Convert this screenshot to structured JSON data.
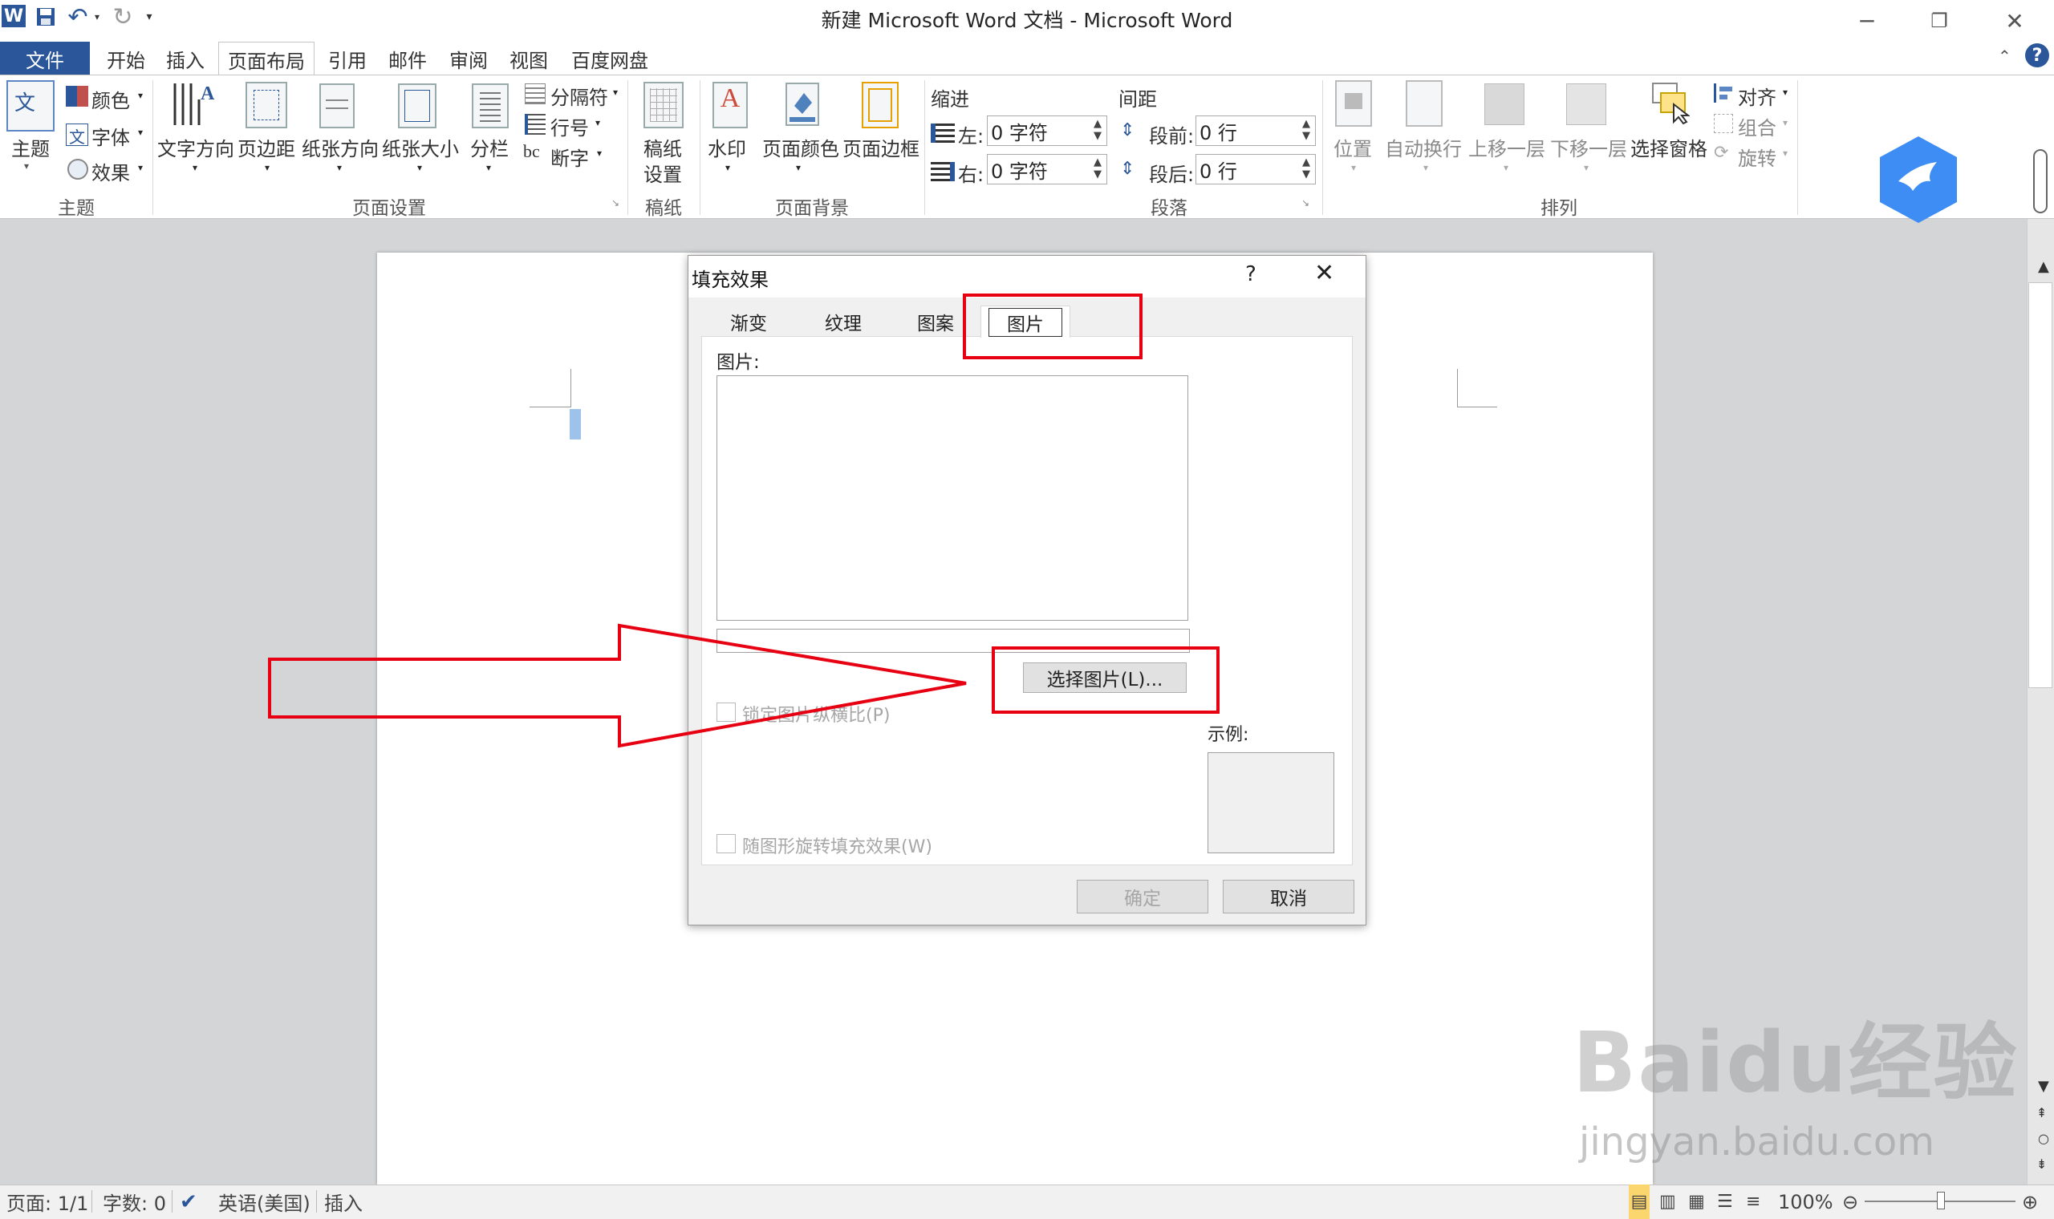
{
  "titlebar": {
    "title": "新建 Microsoft Word 文档 - Microsoft Word"
  },
  "tabs": [
    "文件",
    "开始",
    "插入",
    "页面布局",
    "引用",
    "邮件",
    "审阅",
    "视图",
    "百度网盘"
  ],
  "ribbon": {
    "theme": {
      "themes_label": "主题",
      "colors_label": "颜色",
      "fonts_label": "字体",
      "effects_label": "效果",
      "group_label": "主题"
    },
    "page_setup": {
      "text_dir": "文字方向",
      "margins": "页边距",
      "orientation": "纸张方向",
      "size": "纸张大小",
      "columns": "分栏",
      "breaks": "分隔符",
      "line_numbers": "行号",
      "hyphenation": "断字",
      "group_label": "页面设置"
    },
    "manuscript": {
      "label_line1": "稿纸",
      "label_line2": "设置",
      "group_label": "稿纸"
    },
    "page_background": {
      "watermark": "水印",
      "page_color": "页面颜色",
      "page_borders": "页面边框",
      "group_label": "页面背景"
    },
    "paragraph": {
      "indent_title": "缩进",
      "indent_left_label": "左:",
      "indent_left_value": "0 字符",
      "indent_right_label": "右:",
      "indent_right_value": "0 字符",
      "spacing_title": "间距",
      "before_label": "段前:",
      "before_value": "0 行",
      "after_label": "段后:",
      "after_value": "0 行",
      "group_label": "段落"
    },
    "arrange": {
      "position": "位置",
      "wrap": "自动换行",
      "bring_forward": "上移一层",
      "send_backward": "下移一层",
      "selection_pane": "选择窗格",
      "align": "对齐",
      "group": "组合",
      "rotate": "旋转",
      "group_label": "排列"
    }
  },
  "dialog": {
    "title": "填充效果",
    "help": "?",
    "tabs": [
      "渐变",
      "纹理",
      "图案",
      "图片"
    ],
    "picture_label": "图片:",
    "select_picture_button": "选择图片(L)...",
    "lock_aspect_label": "锁定图片纵横比(P)",
    "rotate_with_shape_label": "随图形旋转填充效果(W)",
    "sample_label": "示例:",
    "ok_button": "确定",
    "cancel_button": "取消"
  },
  "statusbar": {
    "page": "页面: 1/1",
    "words": "字数: 0",
    "language": "英语(美国)",
    "mode": "插入",
    "zoom": "100%"
  },
  "watermark": {
    "brand": "Baidu经验",
    "url": "jingyan.baidu.com"
  },
  "colors": {
    "accent": "#2b579a",
    "annotation": "#e60012"
  }
}
